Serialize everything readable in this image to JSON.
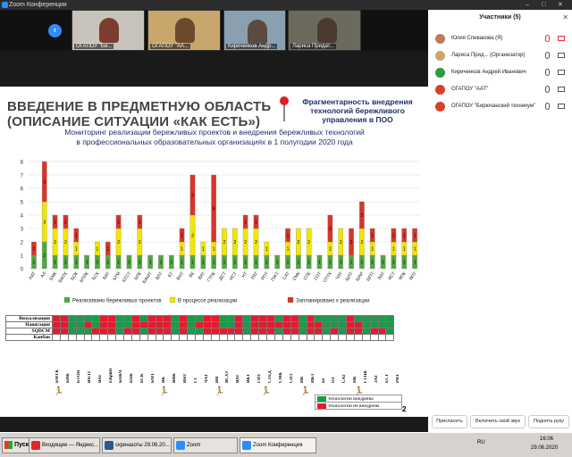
{
  "window": {
    "title": "Zoom Конференция"
  },
  "thumbnails": [
    {
      "name": "ОГАПОУ \"Би...",
      "bg": "#c9c4bb",
      "person": "#7a3d2e"
    },
    {
      "name": "ОГАПОУ \"АА...",
      "bg": "#c9a66b",
      "person": "#6b4a2c"
    },
    {
      "name": "Кириченков Андр...",
      "bg": "#8aa0b0",
      "person": "#5a4a40"
    },
    {
      "name": "Лариса Придат...",
      "bg": "#6c6a5c",
      "person": "#4a3a30"
    }
  ],
  "slide": {
    "title_line1": "ВВЕДЕНИЕ В ПРЕДМЕТНУЮ ОБЛАСТЬ",
    "title_line2": "(ОПИСАНИЕ СИТУАЦИИ «КАК ЕСТЬ»)",
    "side_note": "Фрагментарность внедрения технологий бережливого управления в ПОО",
    "legend_green": "технологии внедрены",
    "legend_red": "технологии не внедрены",
    "legend_number": "2"
  },
  "chart_data": {
    "type": "bar",
    "stacked": true,
    "title": "Мониторинг реализации бережливых проектов и внедрения бережливых технологий",
    "subtitle": "в профессиональных образовательных организациях в 1 полугодии 2020 года",
    "ylim": [
      0,
      8
    ],
    "yticks": [
      "0",
      "1",
      "2",
      "3",
      "4",
      "5",
      "6",
      "7",
      "8"
    ],
    "categories": [
      "ААТ",
      "АЛ",
      "БМК",
      "БМТК",
      "БОК",
      "БПЛК",
      "БСК",
      "ВАТ",
      "БТМ",
      "БТСТ",
      "БПК",
      "БЖИТ",
      "ВЛТ",
      "БТ",
      "ВНТ",
      "ВК",
      "ВАТ",
      "ГТПК",
      "ДСТ",
      "ИСТ",
      "НТ",
      "РАТ",
      "РПТ",
      "ПЖТ",
      "САТ",
      "СМК",
      "СПК",
      "СПТ",
      "СПТК",
      "ЧАТ",
      "ШЛТ",
      "ШАР",
      "ШПТ",
      "ЯАТ",
      "ЯСТ",
      "ЯПК",
      "ЯПТ"
    ],
    "series": [
      {
        "name": "Реализовано бережливых проектов",
        "color": "#4fa83d",
        "values": [
          1,
          2,
          1,
          1,
          1,
          1,
          1,
          1,
          1,
          1,
          1,
          1,
          1,
          1,
          1,
          1,
          1,
          1,
          1,
          1,
          1,
          1,
          1,
          1,
          1,
          1,
          1,
          1,
          1,
          1,
          1,
          1,
          1,
          1,
          1,
          1,
          1
        ]
      },
      {
        "name": "В процессе реализации",
        "color": "#f2e600",
        "values": [
          0,
          3,
          2,
          2,
          1,
          0,
          1,
          0,
          2,
          0,
          2,
          0,
          0,
          0,
          1,
          3,
          1,
          1,
          2,
          2,
          2,
          2,
          1,
          0,
          1,
          2,
          2,
          0,
          1,
          2,
          0,
          2,
          1,
          0,
          1,
          1,
          1
        ]
      },
      {
        "name": "Запланировано к реализации",
        "color": "#d9342b",
        "values": [
          1,
          3,
          1,
          1,
          1,
          0,
          0,
          1,
          1,
          0,
          1,
          0,
          0,
          0,
          1,
          3,
          0,
          5,
          0,
          0,
          1,
          1,
          0,
          0,
          1,
          0,
          0,
          0,
          2,
          0,
          2,
          2,
          1,
          0,
          1,
          1,
          1
        ]
      }
    ],
    "segment_labels": "1"
  },
  "matrix": {
    "rows": [
      "Визуализация",
      "Навигация",
      "SQDCM",
      "Канбан"
    ],
    "cells": [
      [
        0,
        0,
        1,
        1,
        1,
        1,
        0,
        0,
        1,
        1,
        0,
        1,
        0,
        0,
        0,
        1,
        0,
        1,
        1,
        0,
        0,
        1,
        1,
        0,
        1,
        0,
        0,
        0,
        1,
        0,
        0,
        1,
        0,
        1,
        1,
        1,
        1,
        0,
        1,
        1,
        1,
        1,
        1
      ],
      [
        0,
        0,
        1,
        1,
        0,
        1,
        0,
        0,
        1,
        1,
        0,
        0,
        0,
        0,
        0,
        1,
        0,
        1,
        0,
        0,
        0,
        1,
        1,
        0,
        1,
        0,
        0,
        0,
        0,
        0,
        0,
        1,
        0,
        0,
        1,
        1,
        1,
        0,
        0,
        1,
        1,
        1,
        1
      ],
      [
        0,
        0,
        1,
        1,
        1,
        0,
        0,
        0,
        1,
        0,
        0,
        1,
        0,
        0,
        0,
        1,
        0,
        1,
        1,
        0,
        0,
        0,
        0,
        0,
        1,
        0,
        0,
        0,
        1,
        0,
        0,
        1,
        0,
        0,
        1,
        0,
        1,
        0,
        0,
        1,
        0,
        0,
        1
      ],
      [
        0,
        0,
        0,
        0,
        0,
        0,
        0,
        0,
        0,
        0,
        0,
        0,
        0,
        0,
        0,
        0,
        0,
        0,
        0,
        0,
        0,
        0,
        0,
        0,
        0,
        0,
        0,
        0,
        0,
        0,
        0,
        0,
        0,
        0,
        0,
        0,
        0,
        0,
        0,
        0,
        0,
        0,
        0
      ]
    ],
    "codes": [
      "БМТК",
      "БИК",
      "БТОН",
      "ВАЛТ",
      "ВАТ",
      "ЕКрйП",
      "БПКЧ",
      "БПК",
      "БСК",
      "БМТ",
      "ВК",
      "ВИК",
      "ВНТ",
      "ГТ",
      "ЧАТ",
      "ВИ",
      "ВСХТ",
      "ВАТ",
      "ВКТ",
      "ГИТ",
      "СТЕД",
      "СМК",
      "СПТ",
      "ИК",
      "ИКТ",
      "БГ",
      "ПТ",
      "САТ",
      "НК",
      "ГТПК",
      "ЗАТ",
      "ЕСТ",
      "РИТ"
    ]
  },
  "participants": {
    "title": "Участники (5)",
    "list": [
      {
        "name": "Юлия Спивакова (Я)",
        "avatar": "#c07a5a"
      },
      {
        "name": "Лариса Прид... (Организатор)",
        "avatar": "#c9a66b"
      },
      {
        "name": "Кириченков Андрей Иванович",
        "avatar": "#2e9a44"
      },
      {
        "name": "ОГАПОУ \"ААТ\"",
        "avatar": "#d9402c"
      },
      {
        "name": "ОГАПОУ \"Бирючанский техникум\"",
        "avatar": "#d9402c"
      }
    ],
    "buttons": [
      "Пригласить",
      "Включить свой звук",
      "Поднять руку"
    ]
  },
  "taskbar": {
    "start": "Пуск",
    "items": [
      {
        "label": "Входящие — Яндекс...",
        "color": "#e0262b"
      },
      {
        "label": "скриншоты 29.06.20...",
        "color": "#2b5797"
      },
      {
        "label": "Zoom",
        "color": "#2d8cff"
      },
      {
        "label": "Zoom Конференция",
        "color": "#2d8cff"
      }
    ],
    "lang": "RU",
    "time": "16:06",
    "date": "29.06.2020"
  }
}
